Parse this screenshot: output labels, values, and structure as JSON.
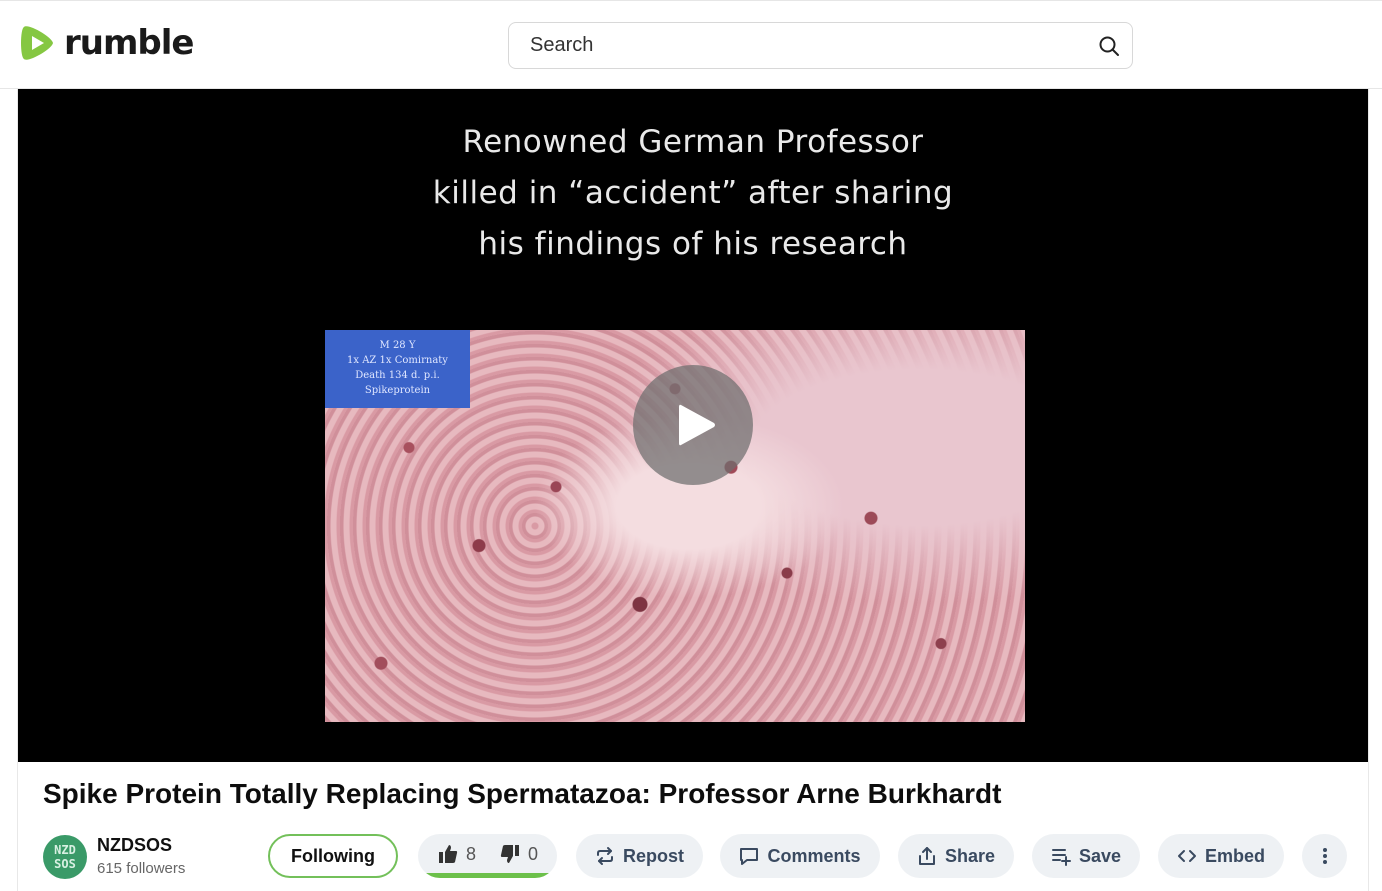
{
  "header": {
    "logo_text": "rumble",
    "search_placeholder": "Search"
  },
  "player": {
    "caption_lines": [
      "Renowned German Professor",
      "killed in “accident” after sharing",
      "his findings of his research"
    ],
    "slide_label_lines": [
      "M 28 Y",
      "1x AZ 1x Comirnaty",
      "Death 134 d. p.i.",
      "Spikeprotein"
    ]
  },
  "video": {
    "title": "Spike Protein Totally Replacing Spermatazoa: Professor Arne Burkhardt"
  },
  "channel": {
    "avatar_line1": "NZD",
    "avatar_line2": "SOS",
    "name": "NZDSOS",
    "followers": "615 followers",
    "follow_label": "Following"
  },
  "actions": {
    "likes": "8",
    "dislikes": "0",
    "like_fraction": 1.0,
    "repost": "Repost",
    "comments": "Comments",
    "share": "Share",
    "save": "Save",
    "embed": "Embed"
  },
  "colors": {
    "brand_green": "#85c742",
    "vote_bar": "#6cc04a",
    "button_bg": "#eef1f4"
  }
}
